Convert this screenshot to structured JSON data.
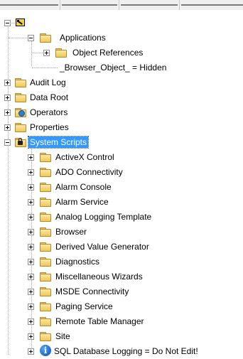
{
  "tree": {
    "root": {
      "icon": "root-pen-icon"
    },
    "applications": {
      "label": "Applications",
      "children": [
        {
          "label": "Object References"
        },
        {
          "label": "_Browser_Object_ = Hidden"
        }
      ]
    },
    "top_level": [
      {
        "label": "Audit Log"
      },
      {
        "label": "Data Root"
      },
      {
        "label": "Operators",
        "icon": "operators-folder-icon"
      },
      {
        "label": "Properties"
      }
    ],
    "system_scripts": {
      "label": "System Scripts",
      "icon": "locked-folder-icon",
      "selected": true,
      "children": [
        {
          "label": "ActiveX Control"
        },
        {
          "label": "ADO Connectivity"
        },
        {
          "label": "Alarm Console"
        },
        {
          "label": "Alarm Service"
        },
        {
          "label": "Analog Logging Template"
        },
        {
          "label": "Browser"
        },
        {
          "label": "Derived Value Generator"
        },
        {
          "label": "Diagnostics"
        },
        {
          "label": "Miscellaneous Wizards"
        },
        {
          "label": "MSDE Connectivity"
        },
        {
          "label": "Paging Service"
        },
        {
          "label": "Remote Table Manager"
        },
        {
          "label": "Site"
        },
        {
          "label": "SQL Database Logging = Do Not Edit!",
          "icon": "info-icon"
        }
      ]
    }
  },
  "colors": {
    "selection": "#3399ff",
    "folder": "#efc757",
    "info": "#0b4fb3"
  }
}
